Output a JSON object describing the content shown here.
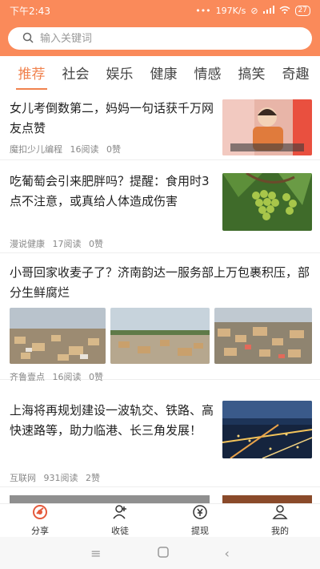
{
  "status": {
    "time": "下午2:43",
    "dots": "•••",
    "speed": "197K/s",
    "battery": "27"
  },
  "search": {
    "placeholder": "输入关键词"
  },
  "tabs": [
    "推荐",
    "社会",
    "娱乐",
    "健康",
    "情感",
    "搞笑",
    "奇趣"
  ],
  "feed": [
    {
      "title": "女儿考倒数第二，妈妈一句话获千万网友点赞",
      "source": "魔扣少儿编程",
      "reads": "16阅读",
      "likes": "0赞"
    },
    {
      "title": "吃葡萄会引来肥胖吗？提醒：食用时3点不注意，或真给人体造成伤害",
      "source": "漫说健康",
      "reads": "17阅读",
      "likes": "0赞"
    },
    {
      "title": "小哥回家收麦子了？济南韵达一服务部上万包裹积压，部分生鲜腐烂",
      "source": "齐鲁壹点",
      "reads": "16阅读",
      "likes": "0赞"
    },
    {
      "title": "上海将再规划建设一波轨交、铁路、高快速路等，助力临港、长三角发展！",
      "source": "互联网",
      "reads": "931阅读",
      "likes": "2赞"
    }
  ],
  "nav": [
    {
      "label": "分享",
      "icon": "share-icon"
    },
    {
      "label": "收徒",
      "icon": "add-user-icon"
    },
    {
      "label": "提现",
      "icon": "withdraw-icon"
    },
    {
      "label": "我的",
      "icon": "profile-icon"
    }
  ],
  "colors": {
    "accent": "#fa8a5a",
    "tab_active": "#f0824e"
  }
}
